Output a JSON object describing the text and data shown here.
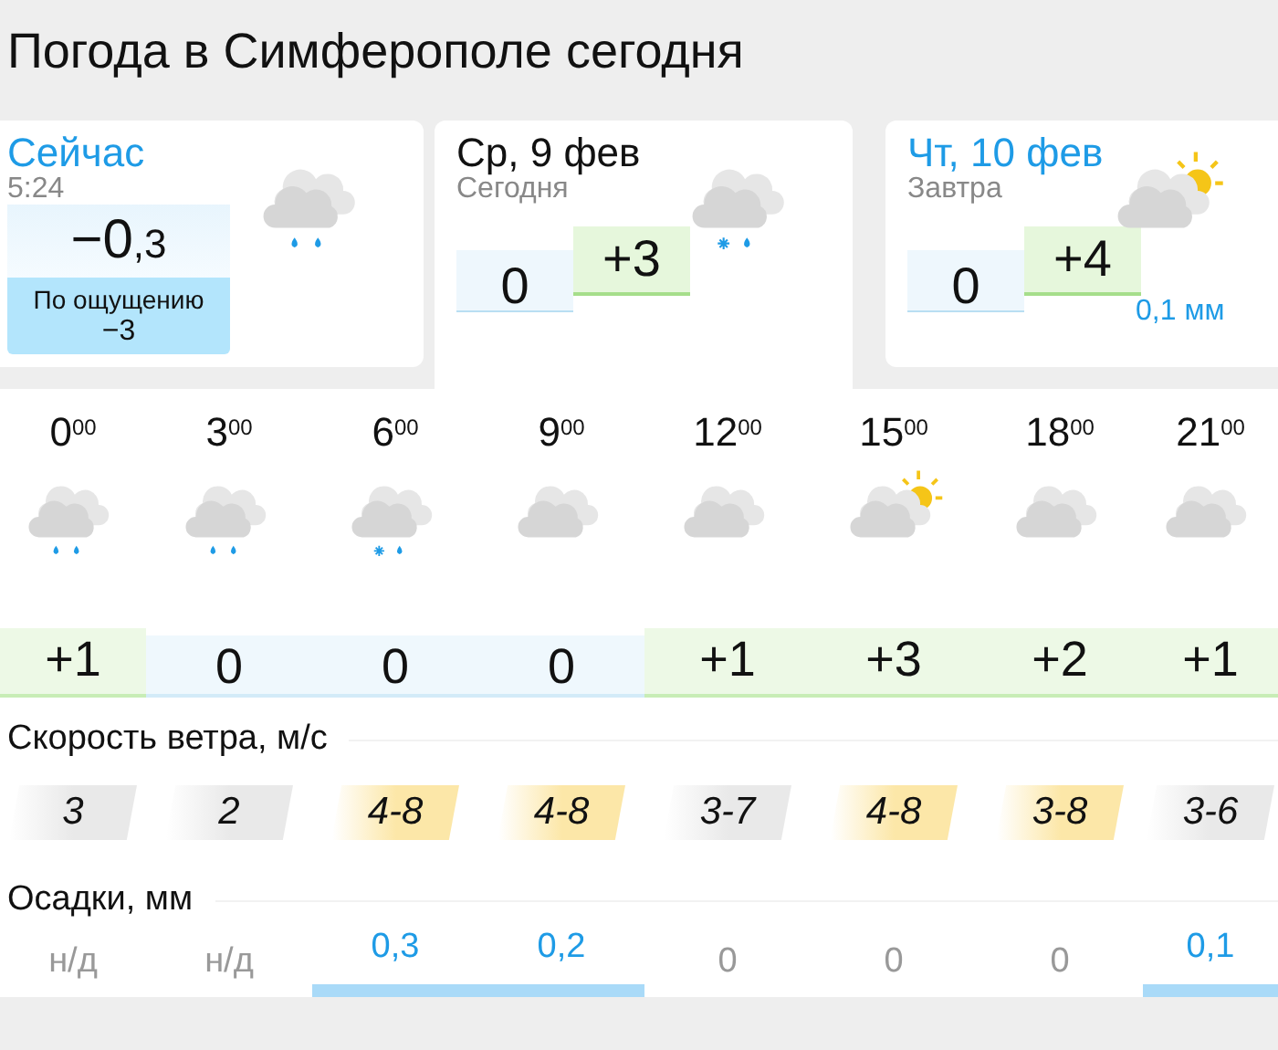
{
  "title": "Погода в Симферополе сегодня",
  "now": {
    "heading": "Сейчас",
    "time": "5:24",
    "temp_whole": "−0",
    "temp_fraction": ",3",
    "feels_label": "По ощущению",
    "feels_value": "−3",
    "kind": "rain"
  },
  "days": [
    {
      "heading": "Ср, 9 фев",
      "subheading": "Сегодня",
      "highlight": false,
      "kind": "snow_rain",
      "min": "0",
      "max": "+3"
    },
    {
      "heading": "Чт, 10 фев",
      "subheading": "Завтра",
      "highlight": true,
      "kind": "partly_sunny",
      "min": "0",
      "max": "+4",
      "precip": "0,1 мм"
    }
  ],
  "hours": [
    {
      "time": "0$^{00}$",
      "kind": "rain",
      "temp": "+1",
      "warm": true
    },
    {
      "time": "3$^{00}$",
      "kind": "rain",
      "temp": "0",
      "warm": false
    },
    {
      "time": "6$^{00}$",
      "kind": "snow_rain",
      "temp": "0",
      "warm": false
    },
    {
      "time": "9$^{00}$",
      "kind": "cloudy",
      "temp": "0",
      "warm": false
    },
    {
      "time": "12$^{00}$",
      "kind": "cloudy",
      "temp": "+1",
      "warm": true
    },
    {
      "time": "15$^{00}$",
      "kind": "partly_sunny",
      "temp": "+3",
      "warm": true
    },
    {
      "time": "18$^{00}$",
      "kind": "cloudy",
      "temp": "+2",
      "warm": true
    },
    {
      "time": "21$^{00}$",
      "kind": "cloudy",
      "temp": "+1",
      "warm": true
    }
  ],
  "wind": {
    "heading": "Скорость ветра, м/с",
    "values": [
      {
        "value": "3",
        "strong": false
      },
      {
        "value": "2",
        "strong": false
      },
      {
        "value": "4-8",
        "strong": true
      },
      {
        "value": "4-8",
        "strong": true
      },
      {
        "value": "3-7",
        "strong": false
      },
      {
        "value": "4-8",
        "strong": true
      },
      {
        "value": "3-8",
        "strong": true
      },
      {
        "value": "3-6",
        "strong": false
      }
    ]
  },
  "precipitation": {
    "heading": "Осадки, мм",
    "values": [
      {
        "value": "н/д",
        "bar": false
      },
      {
        "value": "н/д",
        "bar": false
      },
      {
        "value": "0,3",
        "bar": true
      },
      {
        "value": "0,2",
        "bar": true
      },
      {
        "value": "0",
        "bar": false
      },
      {
        "value": "0",
        "bar": false
      },
      {
        "value": "0",
        "bar": false
      },
      {
        "value": "0,1",
        "bar": true
      }
    ]
  }
}
